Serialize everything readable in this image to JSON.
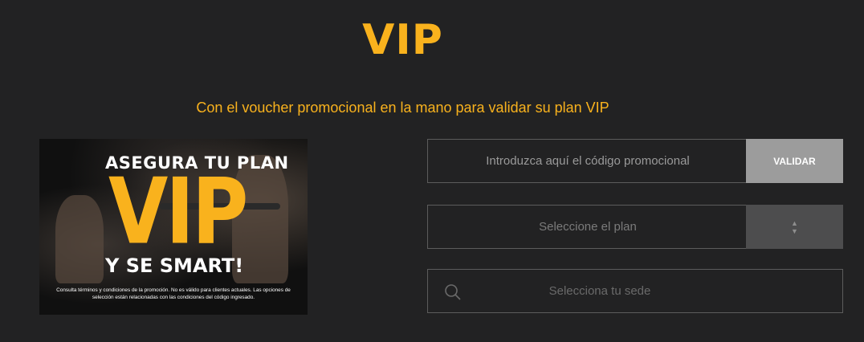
{
  "header": {
    "title": "VIP",
    "subtitle": "Con el voucher promocional en la mano para validar su plan VIP"
  },
  "promo": {
    "line1": "ASEGURA TU PLAN",
    "big": "VIP",
    "line2": "Y SE SMART!",
    "fine_print": "Consulta términos y condiciones de la promoción. No es válido para clientes actuales. Las opciones de selección están relacionadas con las condiciones del código ingresado."
  },
  "form": {
    "code": {
      "placeholder": "Introduzca aquí el código promocional",
      "button_label": "VALIDAR"
    },
    "plan": {
      "label": "Seleccione el plan",
      "icon": "sort-arrows-icon"
    },
    "site": {
      "label": "Selecciona tu sede",
      "icon": "search-icon"
    }
  },
  "colors": {
    "background": "#222223",
    "accent": "#f9b21d",
    "button": "#9c9c9c"
  }
}
